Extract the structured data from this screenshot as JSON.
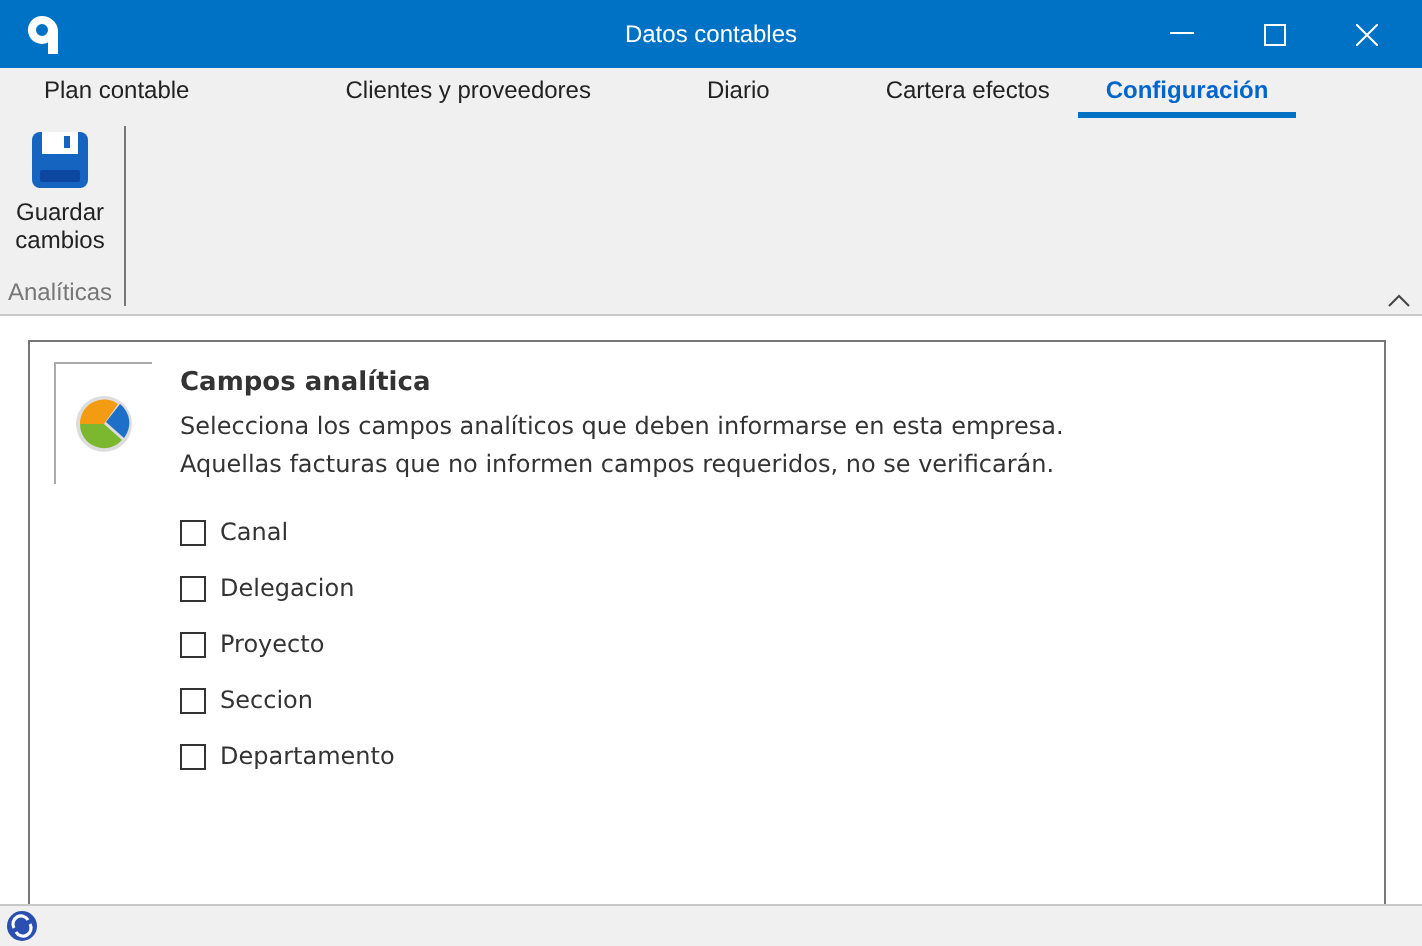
{
  "window": {
    "title": "Datos contables"
  },
  "tabs": [
    {
      "label": "Plan contable",
      "selected": false
    },
    {
      "label": "Clientes y proveedores",
      "selected": false
    },
    {
      "label": "Diario",
      "selected": false
    },
    {
      "label": "Cartera efectos",
      "selected": false
    },
    {
      "label": "Configuración",
      "selected": true
    }
  ],
  "ribbon": {
    "buttons": [
      {
        "label": "Guardar cambios"
      }
    ],
    "group_label": "Analíticas"
  },
  "section": {
    "title": "Campos analítica",
    "description": [
      "Selecciona los campos analíticos que deben informarse en esta empresa.",
      "Aquellas facturas que no informen campos requeridos, no se verificarán."
    ],
    "fields": [
      {
        "label": "Canal",
        "checked": false
      },
      {
        "label": "Delegacion",
        "checked": false
      },
      {
        "label": "Proyecto",
        "checked": false
      },
      {
        "label": "Seccion",
        "checked": false
      },
      {
        "label": "Departamento",
        "checked": false
      }
    ]
  }
}
